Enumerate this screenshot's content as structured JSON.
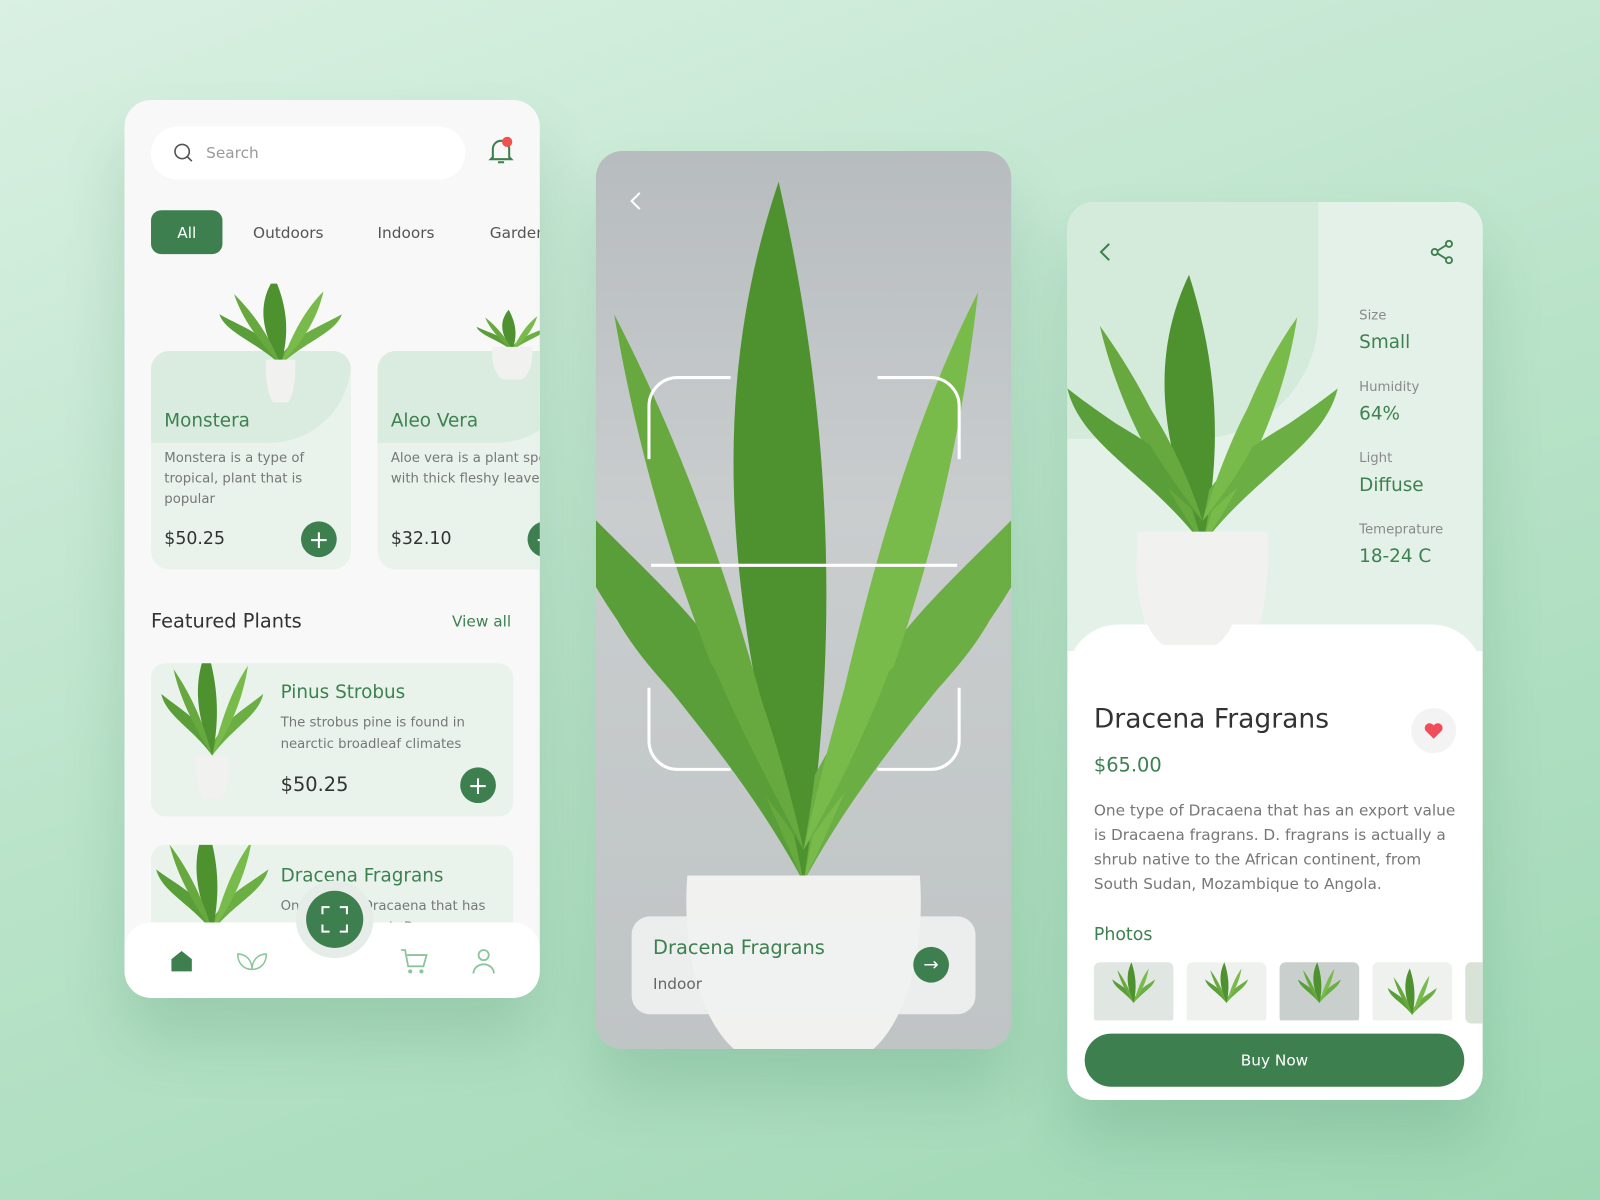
{
  "home": {
    "search_placeholder": "Search",
    "tabs": [
      {
        "label": "All",
        "active": true
      },
      {
        "label": "Outdoors"
      },
      {
        "label": "Indoors"
      },
      {
        "label": "Garden"
      }
    ],
    "cards": [
      {
        "name": "Monstera",
        "desc": "Monstera is a type of tropical, plant that is popular",
        "price": "$50.25"
      },
      {
        "name": "Aleo Vera",
        "desc": "Aloe vera  is a plant species with thick fleshy leaves",
        "price": "$32.10"
      }
    ],
    "featured_title": "Featured Plants",
    "view_all": "View all",
    "featured": [
      {
        "name": "Pinus Strobus",
        "desc": "The strobus pine is found in nearctic broadleaf climates",
        "price": "$50.25"
      },
      {
        "name": "Dracena Fragrans",
        "desc": "One type of Dracaena that has an export value is Dracaena"
      }
    ],
    "nav": [
      "home-icon",
      "leaf-icon",
      "scan-icon",
      "cart-icon",
      "user-icon"
    ]
  },
  "scan": {
    "name": "Dracena Fragrans",
    "type": "Indoor"
  },
  "detail": {
    "stats": [
      {
        "label": "Size",
        "value": "Small"
      },
      {
        "label": "Humidity",
        "value": "64%"
      },
      {
        "label": "Light",
        "value": "Diffuse"
      },
      {
        "label": "Temeprature",
        "value": "18-24 C"
      }
    ],
    "name": "Dracena Fragrans",
    "price": "$65.00",
    "description": "One type of Dracaena that has an export value is Dracaena fragrans. D. fragrans is actually a shrub native to the African continent, from South Sudan, Mozambique to Angola.",
    "photos_title": "Photos",
    "buy_label": "Buy Now"
  },
  "colors": {
    "accent": "#3e7f4f",
    "notification": "#f05252",
    "heart": "#ef4d5a"
  }
}
